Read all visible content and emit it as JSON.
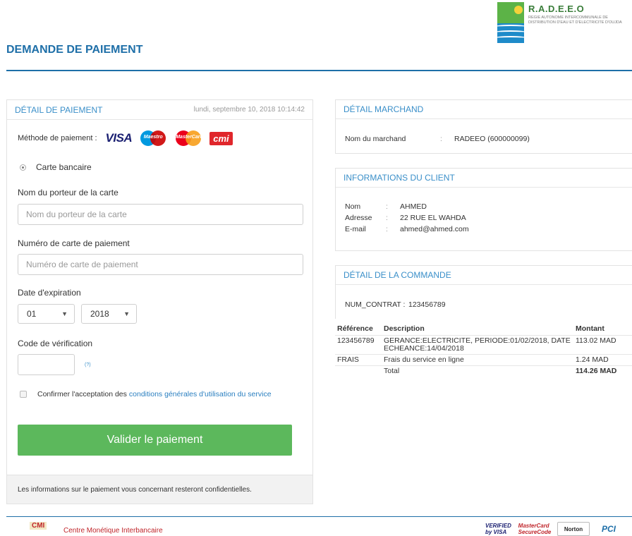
{
  "header": {
    "title": "DEMANDE DE PAIEMENT",
    "logo_name": "R.A.D.E.E.O",
    "logo_subtitle": "REGIE AUTONOME INTERCOMMUNALE DE DISTRIBUTION D'EAU ET D'ELECTRICITE D'OUJDA"
  },
  "payment": {
    "title": "DÉTAIL DE PAIEMENT",
    "datetime": "lundi, septembre 10, 2018 10:14:42",
    "method_label": "Méthode de paiement :",
    "card_logos": {
      "visa": "VISA",
      "maestro": "Maestro",
      "mastercard": "MasterCard",
      "cmi": "cmi"
    },
    "radio_label": "Carte bancaire",
    "holder_label": "Nom du porteur de la carte",
    "holder_placeholder": "Nom du porteur de la carte",
    "number_label": "Numéro de carte de paiement",
    "number_placeholder": "Numéro de carte de paiement",
    "expiry_label": "Date d'expiration",
    "expiry_month": "01",
    "expiry_year": "2018",
    "cvv_label": "Code de vérification",
    "cvv_help": "(?)",
    "terms_prefix": "Confirmer l'acceptation des",
    "terms_link": "conditions générales d'utilisation du service",
    "submit_label": "Valider le paiement",
    "footer_note": "Les informations sur le paiement vous concernant resteront confidentielles."
  },
  "merchant": {
    "title": "DÉTAIL MARCHAND",
    "name_label": "Nom du marchand",
    "sep": ":",
    "name_value": "RADEEO (600000099)"
  },
  "client": {
    "title": "INFORMATIONS DU CLIENT",
    "rows": [
      {
        "label": "Nom",
        "sep": ":",
        "value": "AHMED"
      },
      {
        "label": "Adresse",
        "sep": ":",
        "value": "22 RUE EL WAHDA"
      },
      {
        "label": "E-mail",
        "sep": ":",
        "value": "ahmed@ahmed.com"
      }
    ]
  },
  "order": {
    "title": "DÉTAIL DE LA COMMANDE",
    "contract_label": "NUM_CONTRAT :",
    "contract_value": "123456789",
    "headers": [
      "Référence",
      "Description",
      "Montant"
    ],
    "rows": [
      {
        "ref": "123456789",
        "desc": "GERANCE:ELECTRICITE, PERIODE:01/02/2018, DATE ECHEANCE:14/04/2018",
        "amount": "113.02 MAD"
      },
      {
        "ref": "FRAIS",
        "desc": "Frais du service en ligne",
        "amount": "1.24 MAD"
      }
    ],
    "total_label": "Total",
    "total_value": "114.26 MAD"
  },
  "footer": {
    "cmi_logo": "CMI",
    "cmi_name": "Centre Monétique Interbancaire",
    "badges": [
      "VERIFIED by VISA",
      "MasterCard SecureCode",
      "Norton",
      "PCI"
    ]
  },
  "colors": {
    "accent": "#1e6fa8",
    "link": "#3a8fc9",
    "submit": "#5cb85c",
    "total": "#d9262e"
  }
}
